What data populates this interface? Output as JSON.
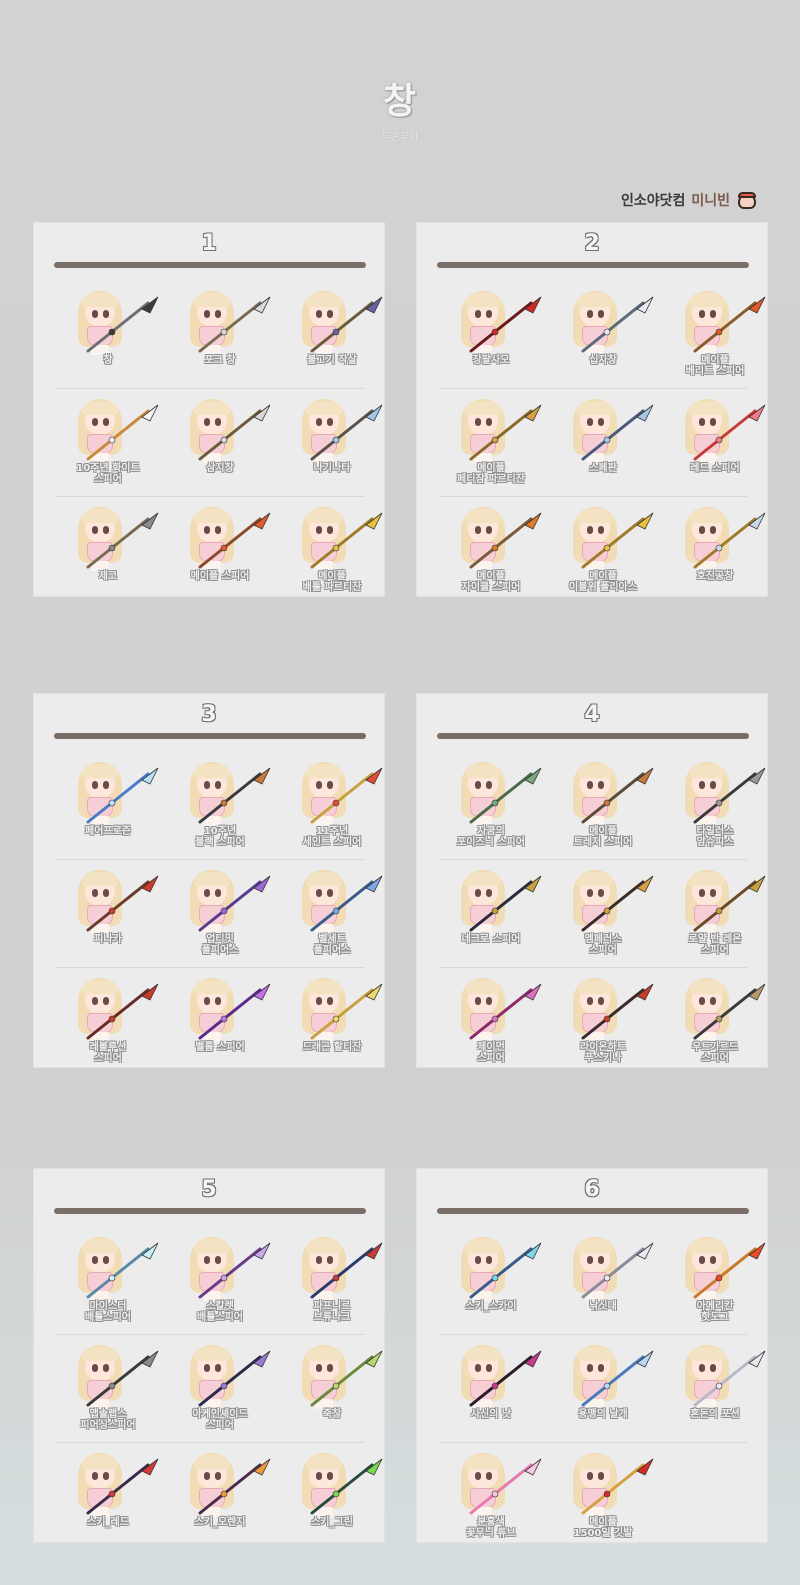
{
  "header": {
    "title": "창",
    "subtitle": "두손무기"
  },
  "credit": {
    "site": "인소야닷컴",
    "name": "미니빈",
    "icon": "mascot-icon"
  },
  "panels": [
    {
      "number": "1",
      "items": [
        {
          "label": "창",
          "color": "#6b6f74",
          "accent": "#3c3c3c"
        },
        {
          "label": "포크 창",
          "color": "#7b6a52",
          "accent": "#d8d8d8"
        },
        {
          "label": "불고기 작살",
          "color": "#6b5a3a",
          "accent": "#6a62a8"
        },
        {
          "label": "10주년 화이트\n스피어",
          "color": "#c98a3c",
          "accent": "#f4f4f4"
        },
        {
          "label": "삼지창",
          "color": "#6b5a3a",
          "accent": "#d8d8d8"
        },
        {
          "label": "나기나타",
          "color": "#5a5048",
          "accent": "#9fc6e8"
        },
        {
          "label": "제코",
          "color": "#7a6a52",
          "accent": "#8a8a8a"
        },
        {
          "label": "메이플 스피어",
          "color": "#8a4a2a",
          "accent": "#e05a2a"
        },
        {
          "label": "메이플\n배틀 파르티잔",
          "color": "#a07a2a",
          "accent": "#e8c040"
        }
      ]
    },
    {
      "number": "2",
      "items": [
        {
          "label": "장팔사모",
          "color": "#6a1a1a",
          "accent": "#d02a2a"
        },
        {
          "label": "십자창",
          "color": "#5a6a7a",
          "accent": "#e8e8f0"
        },
        {
          "label": "메이플\n베리트 스피어",
          "color": "#8a5a2a",
          "accent": "#e05a2a"
        },
        {
          "label": "메이플\n페티잠 파르티잔",
          "color": "#8a6a2a",
          "accent": "#d8a040"
        },
        {
          "label": "스페판",
          "color": "#4a5a7a",
          "accent": "#a8c8e8"
        },
        {
          "label": "레드 스피어",
          "color": "#c83a3a",
          "accent": "#f07a8a"
        },
        {
          "label": "메이플\n자이클 스피어",
          "color": "#7a5a3a",
          "accent": "#e07a2a"
        },
        {
          "label": "메이플\n이블위 폴리아스",
          "color": "#a07a2a",
          "accent": "#e8c040"
        },
        {
          "label": "호진공창",
          "color": "#a07a2a",
          "accent": "#c8dce8"
        }
      ]
    },
    {
      "number": "3",
      "items": [
        {
          "label": "페어프로즌",
          "color": "#4a7ac8",
          "accent": "#b8e0f8"
        },
        {
          "label": "10주년\n블랙 스피어",
          "color": "#3a3a3a",
          "accent": "#c87a3a"
        },
        {
          "label": "11주년\n세인트 스피어",
          "color": "#c8a040",
          "accent": "#e84a3a"
        },
        {
          "label": "피나카",
          "color": "#6a3a2a",
          "accent": "#d03a2a"
        },
        {
          "label": "업티밋\n폴피어스",
          "color": "#5a3a8a",
          "accent": "#9a6ad8"
        },
        {
          "label": "벨세트\n폴피어스",
          "color": "#3a5a8a",
          "accent": "#7aa8e8"
        },
        {
          "label": "레볼루션\n스피어",
          "color": "#6a2a2a",
          "accent": "#c83a2a"
        },
        {
          "label": "벨롬 스피어",
          "color": "#5a2a8a",
          "accent": "#c070e8"
        },
        {
          "label": "드래곤 할티잔",
          "color": "#c8a040",
          "accent": "#f0d870"
        }
      ]
    },
    {
      "number": "4",
      "items": [
        {
          "label": "자쿰의\n포이즈닉 스피어",
          "color": "#4a6a4a",
          "accent": "#7aa87a"
        },
        {
          "label": "메이플\n트레저 스피어",
          "color": "#5a4a3a",
          "accent": "#c87a3a"
        },
        {
          "label": "타일러스\n암슈피스",
          "color": "#3a3a3a",
          "accent": "#9a9a9a"
        },
        {
          "label": "네크로 스피어",
          "color": "#2a2a3a",
          "accent": "#c8a040"
        },
        {
          "label": "엠페러스\n스피어",
          "color": "#3a2a2a",
          "accent": "#d8a040"
        },
        {
          "label": "로얄 반 레온\n스피어",
          "color": "#6a4a2a",
          "accent": "#c8a040"
        },
        {
          "label": "제이먼\n스피어",
          "color": "#8a2a6a",
          "accent": "#e070c0"
        },
        {
          "label": "라이온하트\n푸스키나",
          "color": "#3a2a2a",
          "accent": "#c83a2a"
        },
        {
          "label": "우트가르드\n스피어",
          "color": "#3a3a3a",
          "accent": "#b89a6a"
        }
      ]
    },
    {
      "number": "5",
      "items": [
        {
          "label": "마이스터\n배틀스피어",
          "color": "#5a8aa8",
          "accent": "#c8f0f8"
        },
        {
          "label": "스칼렛\n배틀스피어",
          "color": "#6a3a8a",
          "accent": "#c8a8e8"
        },
        {
          "label": "파프니르\n브류나크",
          "color": "#2a3a6a",
          "accent": "#c83a3a"
        },
        {
          "label": "앱솔랩스\n피어싱스피어",
          "color": "#3a3a3a",
          "accent": "#8a8a8a"
        },
        {
          "label": "아케인셰이드\n스피어",
          "color": "#2a2a4a",
          "accent": "#9a7ad8"
        },
        {
          "label": "죽창",
          "color": "#6a8a3a",
          "accent": "#b8d870"
        },
        {
          "label": "스키_레드",
          "color": "#3a2a4a",
          "accent": "#d83a3a"
        },
        {
          "label": "스키_오렌지",
          "color": "#4a2a4a",
          "accent": "#f09a3a"
        },
        {
          "label": "스키_그린",
          "color": "#2a4a3a",
          "accent": "#7ad84a"
        }
      ]
    },
    {
      "number": "6",
      "items": [
        {
          "label": "스키_스카이",
          "color": "#3a5a8a",
          "accent": "#7ad8e8"
        },
        {
          "label": "낚싯대",
          "color": "#8a8a9a",
          "accent": "#e8e8f0"
        },
        {
          "label": "아메리칸\n핫도그",
          "color": "#c87a2a",
          "accent": "#e84a2a"
        },
        {
          "label": "사신의 낫",
          "color": "#2a1a2a",
          "accent": "#c83a8a"
        },
        {
          "label": "용맹의 날개",
          "color": "#4a7ab8",
          "accent": "#b8d8f8"
        },
        {
          "label": "혼돈의 포션",
          "color": "#b8b8c8",
          "accent": "#e8e8f0"
        },
        {
          "label": "분홍색\n꽃무늬 튜브",
          "color": "#e87ab0",
          "accent": "#f8c8e0"
        },
        {
          "label": "메이플\n1500일 깃발",
          "color": "#d8a040",
          "accent": "#d82a2a"
        }
      ]
    }
  ]
}
